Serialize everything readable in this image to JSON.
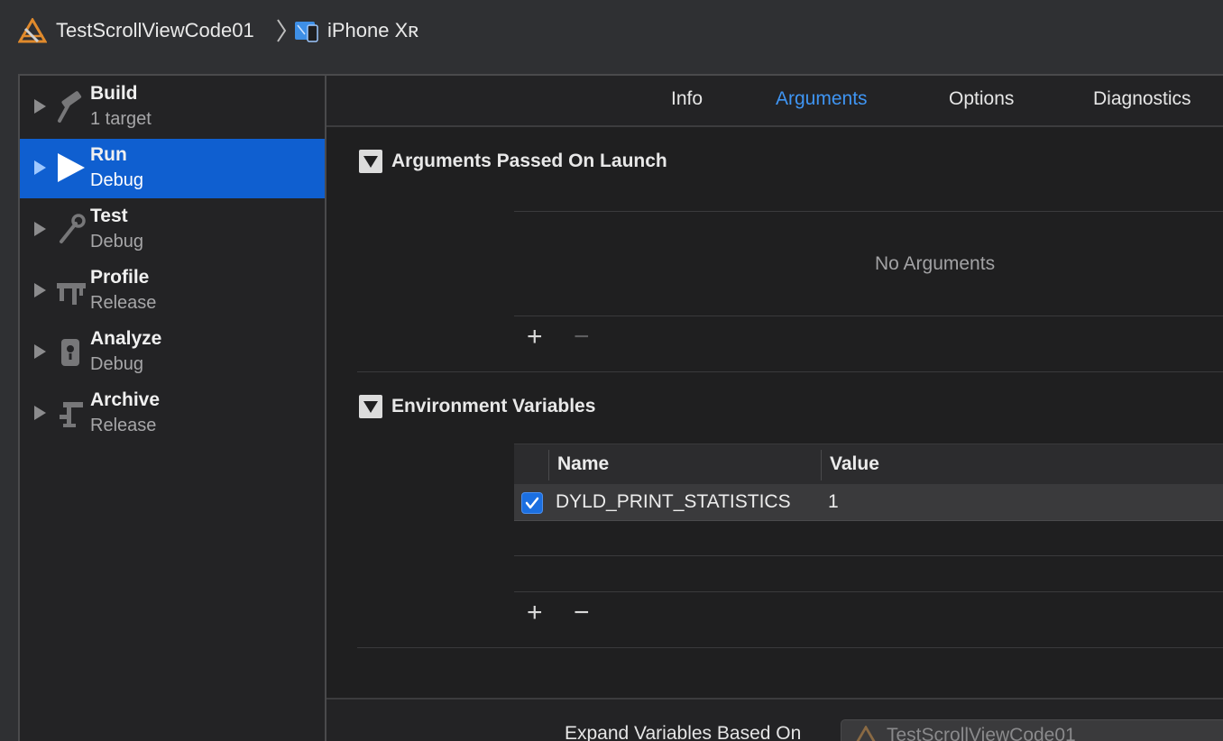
{
  "breadcrumb": {
    "project": "TestScrollViewCode01",
    "device": "iPhone Xʀ"
  },
  "sidebar": {
    "items": [
      {
        "title": "Build",
        "subtitle": "1 target",
        "icon": "hammer-icon",
        "selected": false
      },
      {
        "title": "Run",
        "subtitle": "Debug",
        "icon": "play-icon",
        "selected": true
      },
      {
        "title": "Test",
        "subtitle": "Debug",
        "icon": "wrench-icon",
        "selected": false
      },
      {
        "title": "Profile",
        "subtitle": "Release",
        "icon": "gauge-icon",
        "selected": false
      },
      {
        "title": "Analyze",
        "subtitle": "Debug",
        "icon": "analyze-icon",
        "selected": false
      },
      {
        "title": "Archive",
        "subtitle": "Release",
        "icon": "archive-icon",
        "selected": false
      }
    ]
  },
  "tabs": [
    {
      "label": "Info",
      "active": false
    },
    {
      "label": "Arguments",
      "active": true
    },
    {
      "label": "Options",
      "active": false
    },
    {
      "label": "Diagnostics",
      "active": false
    }
  ],
  "arguments_section": {
    "title": "Arguments Passed On Launch",
    "empty_text": "No Arguments",
    "add": "+",
    "remove": "−"
  },
  "env_section": {
    "title": "Environment Variables",
    "columns": {
      "name": "Name",
      "value": "Value"
    },
    "rows": [
      {
        "enabled": true,
        "name": "DYLD_PRINT_STATISTICS",
        "value": "1"
      }
    ],
    "add": "+",
    "remove": "−"
  },
  "expand": {
    "label": "Expand Variables Based On",
    "selected": "TestScrollViewCode01"
  },
  "colors": {
    "accent": "#0f5fd0",
    "active_tab": "#3f95f3"
  }
}
